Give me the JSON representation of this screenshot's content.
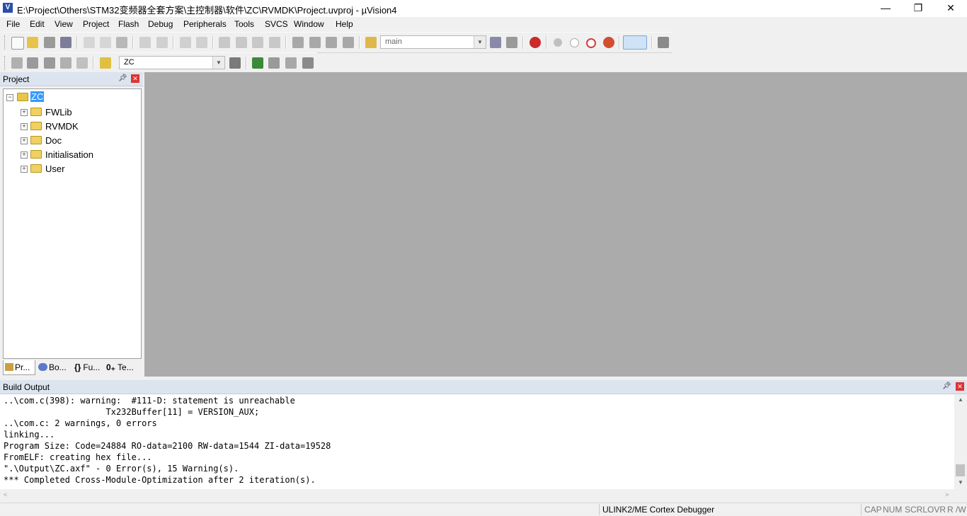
{
  "window": {
    "title": "E:\\Project\\Others\\STM32变频器全套方案\\主控制器\\软件\\ZC\\RVMDK\\Project.uvproj - µVision4",
    "minimize": "—",
    "restore": "❐",
    "close": "✕"
  },
  "menu": [
    "File",
    "Edit",
    "View",
    "Project",
    "Flash",
    "Debug",
    "Peripherals",
    "Tools",
    "SVCS",
    "Window",
    "Help"
  ],
  "toolbar1": {
    "find_combo_value": "main"
  },
  "toolbar2": {
    "target_combo_value": "ZC"
  },
  "project_pane": {
    "title": "Project",
    "root": "ZC",
    "groups": [
      "FWLib",
      "RVMDK",
      "Doc",
      "Initialisation",
      "User"
    ],
    "tabs": [
      "Pr...",
      "Bo...",
      "Fu...",
      "Te..."
    ]
  },
  "build_output": {
    "title": "Build Output",
    "lines": [
      "..\\com.c(398): warning:  #111-D: statement is unreachable",
      "                    Tx232Buffer[11] = VERSION_AUX;",
      "..\\com.c: 2 warnings, 0 errors",
      "linking...",
      "Program Size: Code=24884 RO-data=2100 RW-data=1544 ZI-data=19528",
      "FromELF: creating hex file...",
      "\".\\Output\\ZC.axf\" - 0 Error(s), 15 Warning(s).",
      "*** Completed Cross-Module-Optimization after 2 iteration(s)."
    ]
  },
  "status": {
    "debugger": "ULINK2/ME Cortex Debugger",
    "cap": "CAP",
    "num": "NUM",
    "scrl": "SCRL",
    "ovr": "OVR",
    "rw": "R /W"
  },
  "colors": {
    "workspace": "#ababab",
    "pane_header": "#dce4ef",
    "close_red": "#d33333",
    "selection": "#3399ff"
  }
}
